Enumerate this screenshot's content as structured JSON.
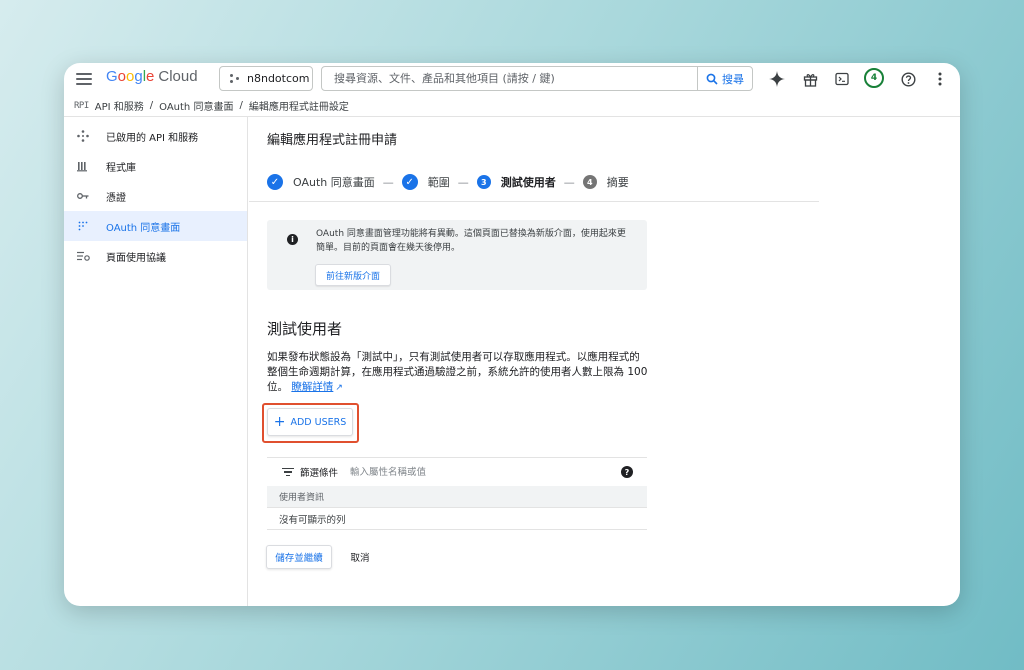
{
  "app": {
    "logo_google": [
      "G",
      "o",
      "o",
      "g",
      "l",
      "e"
    ],
    "logo_cloud": "Cloud",
    "project_name": "n8ndotcom",
    "search_placeholder": "搜尋資源、文件、產品和其他項目 (請按 / 鍵)",
    "search_button": "搜尋",
    "notification_count": "4"
  },
  "breadcrumb": {
    "items": [
      "API 和服務",
      "OAuth 同意畫面",
      "編輯應用程式註冊設定"
    ],
    "separator": "/"
  },
  "sidebar": {
    "items": [
      {
        "label": "已啟用的 API 和服務",
        "icon": "api-diamond-icon"
      },
      {
        "label": "程式庫",
        "icon": "library-icon"
      },
      {
        "label": "憑證",
        "icon": "key-icon"
      },
      {
        "label": "OAuth 同意畫面",
        "icon": "consent-grid-icon",
        "active": true
      },
      {
        "label": "頁面使用協議",
        "icon": "settings-list-icon"
      }
    ]
  },
  "main": {
    "title": "編輯應用程式註冊申請",
    "steps": [
      {
        "label": "OAuth 同意畫面",
        "state": "done"
      },
      {
        "label": "範圍",
        "state": "done"
      },
      {
        "number": "3",
        "label": "測試使用者",
        "state": "current"
      },
      {
        "number": "4",
        "label": "摘要",
        "state": "todo"
      }
    ],
    "step_separator": "—",
    "notice": {
      "text": "OAuth 同意畫面管理功能將有異動。這個頁面已替換為新版介面，使用起來更簡單。目前的頁面會在幾天後停用。",
      "button": "前往新版介面"
    },
    "section": {
      "title": "測試使用者",
      "description": "如果發布狀態設為「測試中」，只有測試使用者可以存取應用程式。以應用程式的整個生命週期計算，在應用程式通過驗證之前，系統允許的使用者人數上限為 100 位。",
      "learn_more": "瞭解詳情"
    },
    "add_users_button": "ADD USERS",
    "filter": {
      "label": "篩選條件",
      "placeholder": "輸入屬性名稱或值"
    },
    "table": {
      "header": "使用者資訊",
      "empty_text": "沒有可顯示的列"
    },
    "save_button": "儲存並繼續",
    "cancel_button": "取消"
  },
  "colors": {
    "accent": "#1a73e8",
    "highlight_box": "#e0502f",
    "active_nav_bg": "#e8f0fe"
  }
}
